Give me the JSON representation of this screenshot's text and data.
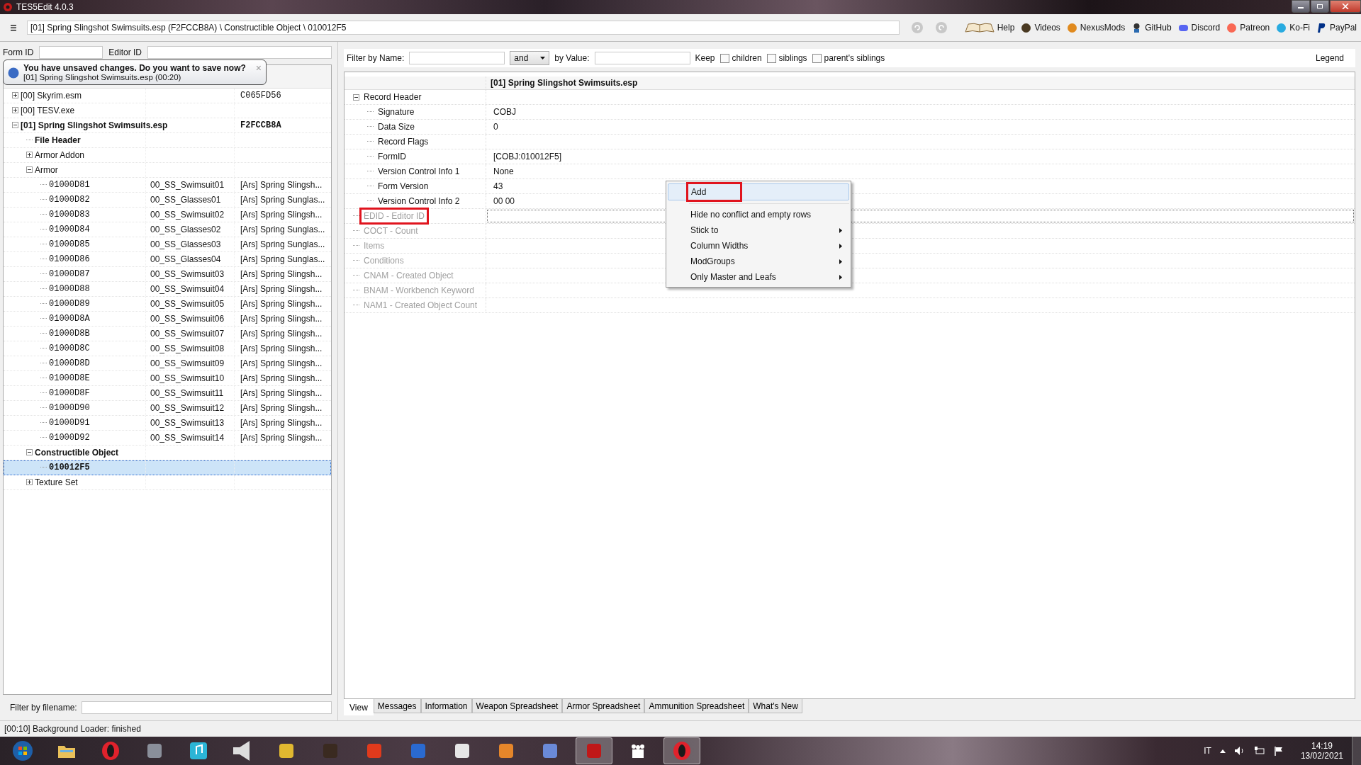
{
  "window": {
    "title": "TES5Edit 4.0.3"
  },
  "toolbar": {
    "path": "[01] Spring Slingshot Swimsuits.esp (F2FCCB8A) \\ Constructible Object \\ 010012F5",
    "links": [
      {
        "kind": "book",
        "label": "Help"
      },
      {
        "kind": "gp",
        "label": "Videos"
      },
      {
        "kind": "nexus",
        "label": "NexusMods"
      },
      {
        "kind": "github",
        "label": "GitHub"
      },
      {
        "kind": "discord",
        "label": "Discord"
      },
      {
        "kind": "patreon",
        "label": "Patreon"
      },
      {
        "kind": "kofi",
        "label": "Ko-Fi"
      },
      {
        "kind": "paypal",
        "label": "PayPal"
      }
    ]
  },
  "left_filter": {
    "form_id_label": "Form ID",
    "editor_id_label": "Editor ID"
  },
  "notification": {
    "title": "You have unsaved changes. Do you want to save now?",
    "message": "[01] Spring Slingshot Swimsuits.esp (00:20)",
    "close": "×"
  },
  "tree": [
    {
      "kind": "node",
      "label": "[00] Skyrim.esm",
      "column_3": "C065FD56",
      "bold": false,
      "expanded": false,
      "selected": false
    },
    {
      "kind": "node",
      "label": "[00] TESV.exe",
      "bold": false,
      "expanded": false,
      "selected": false
    },
    {
      "kind": "node",
      "label": "[01] Spring Slingshot Swimsuits.esp",
      "column_3": "F2FCCB8A",
      "bold": true,
      "expanded": true,
      "selected": false,
      "children": [
        {
          "kind": "leaf",
          "label": "File Header",
          "bold": true,
          "selected": false
        },
        {
          "kind": "node",
          "label": "Armor Addon",
          "bold": false,
          "expanded": false,
          "selected": false
        },
        {
          "kind": "node",
          "label": "Armor",
          "bold": false,
          "expanded": true,
          "selected": false,
          "children": [
            {
              "kind": "record",
              "label": "01000D81",
              "column_2": "00_SS_Swimsuit01",
              "column_3": "[Ars] Spring Slingsh...",
              "bold": false,
              "selected": false
            },
            {
              "kind": "record",
              "label": "01000D82",
              "column_2": "00_SS_Glasses01",
              "column_3": "[Ars] Spring Sunglas...",
              "bold": false,
              "selected": false
            },
            {
              "kind": "record",
              "label": "01000D83",
              "column_2": "00_SS_Swimsuit02",
              "column_3": "[Ars] Spring Slingsh...",
              "bold": false,
              "selected": false
            },
            {
              "kind": "record",
              "label": "01000D84",
              "column_2": "00_SS_Glasses02",
              "column_3": "[Ars] Spring Sunglas...",
              "bold": false,
              "selected": false
            },
            {
              "kind": "record",
              "label": "01000D85",
              "column_2": "00_SS_Glasses03",
              "column_3": "[Ars] Spring Sunglas...",
              "bold": false,
              "selected": false
            },
            {
              "kind": "record",
              "label": "01000D86",
              "column_2": "00_SS_Glasses04",
              "column_3": "[Ars] Spring Sunglas...",
              "bold": false,
              "selected": false
            },
            {
              "kind": "record",
              "label": "01000D87",
              "column_2": "00_SS_Swimsuit03",
              "column_3": "[Ars] Spring Slingsh...",
              "bold": false,
              "selected": false
            },
            {
              "kind": "record",
              "label": "01000D88",
              "column_2": "00_SS_Swimsuit04",
              "column_3": "[Ars] Spring Slingsh...",
              "bold": false,
              "selected": false
            },
            {
              "kind": "record",
              "label": "01000D89",
              "column_2": "00_SS_Swimsuit05",
              "column_3": "[Ars] Spring Slingsh...",
              "bold": false,
              "selected": false
            },
            {
              "kind": "record",
              "label": "01000D8A",
              "column_2": "00_SS_Swimsuit06",
              "column_3": "[Ars] Spring Slingsh...",
              "bold": false,
              "selected": false
            },
            {
              "kind": "record",
              "label": "01000D8B",
              "column_2": "00_SS_Swimsuit07",
              "column_3": "[Ars] Spring Slingsh...",
              "bold": false,
              "selected": false
            },
            {
              "kind": "record",
              "label": "01000D8C",
              "column_2": "00_SS_Swimsuit08",
              "column_3": "[Ars] Spring Slingsh...",
              "bold": false,
              "selected": false
            },
            {
              "kind": "record",
              "label": "01000D8D",
              "column_2": "00_SS_Swimsuit09",
              "column_3": "[Ars] Spring Slingsh...",
              "bold": false,
              "selected": false
            },
            {
              "kind": "record",
              "label": "01000D8E",
              "column_2": "00_SS_Swimsuit10",
              "column_3": "[Ars] Spring Slingsh...",
              "bold": false,
              "selected": false
            },
            {
              "kind": "record",
              "label": "01000D8F",
              "column_2": "00_SS_Swimsuit11",
              "column_3": "[Ars] Spring Slingsh...",
              "bold": false,
              "selected": false
            },
            {
              "kind": "record",
              "label": "01000D90",
              "column_2": "00_SS_Swimsuit12",
              "column_3": "[Ars] Spring Slingsh...",
              "bold": false,
              "selected": false
            },
            {
              "kind": "record",
              "label": "01000D91",
              "column_2": "00_SS_Swimsuit13",
              "column_3": "[Ars] Spring Slingsh...",
              "bold": false,
              "selected": false
            },
            {
              "kind": "record",
              "label": "01000D92",
              "column_2": "00_SS_Swimsuit14",
              "column_3": "[Ars] Spring Slingsh...",
              "bold": false,
              "selected": false
            }
          ]
        },
        {
          "kind": "node",
          "label": "Constructible Object",
          "bold": true,
          "expanded": true,
          "selected": false,
          "children": [
            {
              "kind": "record",
              "label": "010012F5",
              "bold": true,
              "selected": true
            }
          ]
        },
        {
          "kind": "node",
          "label": "Texture Set",
          "bold": false,
          "expanded": false,
          "selected": false
        }
      ]
    }
  ],
  "filename_filter": {
    "label": "Filter by filename:"
  },
  "view_filter": {
    "name_label": "Filter by Name:",
    "operator": "and",
    "value_label": "by Value:",
    "keep_label": "Keep",
    "keep_options": [
      {
        "label": "children",
        "checked": false
      },
      {
        "label": "siblings",
        "checked": false
      },
      {
        "label": "parent's siblings",
        "checked": false
      }
    ],
    "legend": "Legend"
  },
  "record_view": {
    "column_2": "[01] Spring Slingshot Swimsuits.esp",
    "rows": [
      {
        "kind": "node",
        "label": "Record Header",
        "expanded": true,
        "disabled": false,
        "marked": false,
        "children": [
          {
            "label": "Signature",
            "value": "COBJ"
          },
          {
            "label": "Data Size",
            "value": "0"
          },
          {
            "label": "Record Flags"
          },
          {
            "label": "FormID",
            "value": "[COBJ:010012F5]"
          },
          {
            "label": "Version Control Info 1",
            "value": "None"
          },
          {
            "label": "Form Version",
            "value": "43"
          },
          {
            "label": "Version Control Info 2",
            "value": "00 00"
          }
        ]
      },
      {
        "kind": "leaf",
        "label": "EDID - Editor ID",
        "disabled": true,
        "marked": true
      },
      {
        "kind": "leaf",
        "label": "COCT - Count",
        "disabled": true,
        "marked": false
      },
      {
        "kind": "leaf",
        "label": "Items",
        "disabled": true,
        "marked": false
      },
      {
        "kind": "leaf",
        "label": "Conditions",
        "disabled": true,
        "marked": false
      },
      {
        "kind": "leaf",
        "label": "CNAM - Created Object",
        "disabled": true,
        "marked": false
      },
      {
        "kind": "leaf",
        "label": "BNAM - Workbench Keyword",
        "disabled": true,
        "marked": false
      },
      {
        "kind": "leaf",
        "label": "NAM1 - Created Object Count",
        "disabled": true,
        "marked": false
      }
    ]
  },
  "context_menu": [
    {
      "label": "Add",
      "submenu": false,
      "selected": true,
      "marked": true,
      "separator_after": true
    },
    {
      "label": "Hide no conflict and empty rows",
      "submenu": false,
      "selected": false,
      "marked": false,
      "separator_after": false
    },
    {
      "label": "Stick to",
      "submenu": true,
      "selected": false,
      "marked": false,
      "separator_after": false
    },
    {
      "label": "Column Widths",
      "submenu": true,
      "selected": false,
      "marked": false,
      "separator_after": false
    },
    {
      "label": "ModGroups",
      "submenu": true,
      "selected": false,
      "marked": false,
      "separator_after": false
    },
    {
      "label": "Only Master and Leafs",
      "submenu": true,
      "selected": false,
      "marked": false,
      "separator_after": false
    }
  ],
  "tabs": [
    {
      "label": "View",
      "selected": true
    },
    {
      "label": "Messages",
      "selected": false
    },
    {
      "label": "Information",
      "selected": false
    },
    {
      "label": "Weapon Spreadsheet",
      "selected": false
    },
    {
      "label": "Armor Spreadsheet",
      "selected": false
    },
    {
      "label": "Ammunition Spreadsheet",
      "selected": false
    },
    {
      "label": "What's New",
      "selected": false
    }
  ],
  "status_bar": "[00:10] Background Loader: finished",
  "taskbar": {
    "items": [
      {
        "kind": "start",
        "selected": false
      },
      {
        "kind": "folder",
        "selected": false
      },
      {
        "kind": "opera",
        "selected": false
      },
      {
        "kind": "monitor",
        "selected": false
      },
      {
        "kind": "music",
        "selected": false
      },
      {
        "kind": "speaker",
        "selected": false
      },
      {
        "kind": "meter",
        "selected": false
      },
      {
        "kind": "bust",
        "selected": false
      },
      {
        "kind": "letter",
        "selected": false
      },
      {
        "kind": "ffdec",
        "selected": false
      },
      {
        "kind": "window",
        "selected": false
      },
      {
        "kind": "nexus",
        "selected": false
      },
      {
        "kind": "feather",
        "selected": false
      },
      {
        "kind": "dragon",
        "selected": true
      },
      {
        "kind": "people",
        "selected": false
      },
      {
        "kind": "opera",
        "selected": true
      }
    ],
    "language": "IT",
    "time": "14:19",
    "date": "13/02/2021"
  }
}
